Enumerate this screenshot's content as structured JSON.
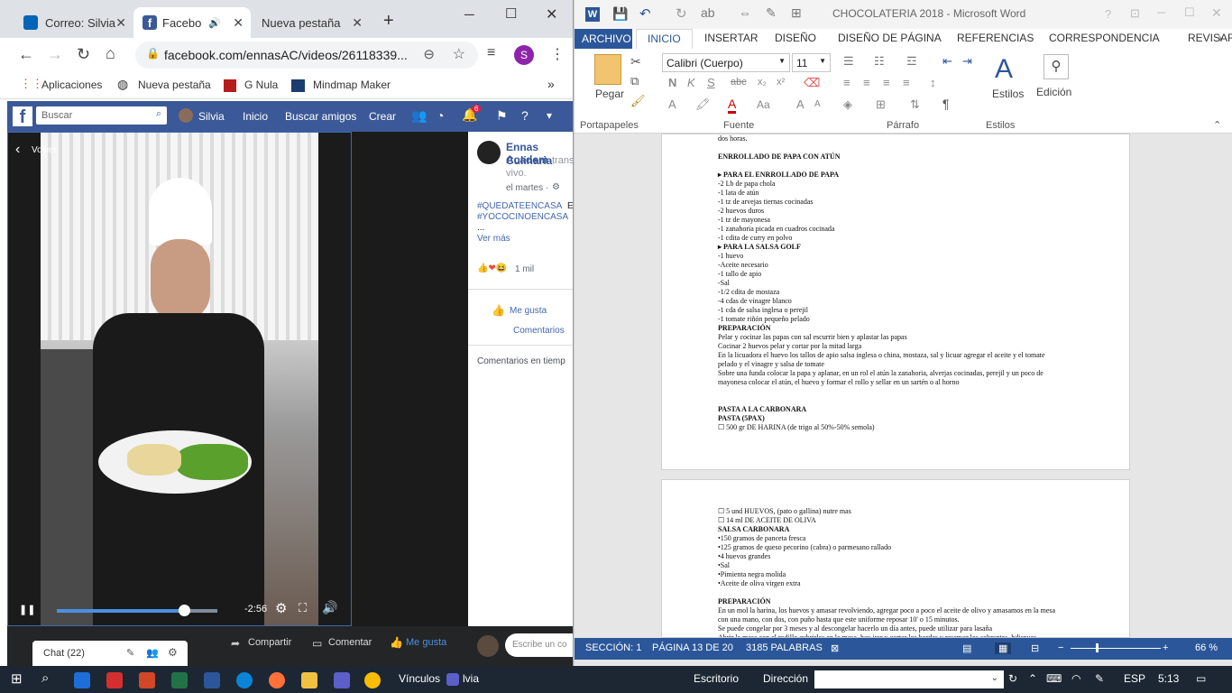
{
  "chrome": {
    "tabs": [
      {
        "label": "Correo: Silvia",
        "active": false
      },
      {
        "label": "Facebo",
        "active": true
      },
      {
        "label": "Nueva pestaña",
        "active": false
      }
    ],
    "new_tab_symbol": "+",
    "url": "facebook.com/ennasAC/videos/26118339...",
    "profile_letter": "S",
    "bookmarks": [
      "Aplicaciones",
      "Nueva pestaña",
      "G Nula",
      "Mindmap Maker"
    ],
    "more_symbol": "»"
  },
  "facebook": {
    "search_placeholder": "Buscar",
    "user": "Silvia",
    "nav": [
      "Inicio",
      "Buscar amigos",
      "Crear"
    ],
    "notification_count": "6",
    "video": {
      "back_label": "Volver",
      "time_remaining": "-2:56",
      "progress": 0.79
    },
    "post": {
      "page_name_1": "Ennas Academ",
      "page_name_2": "Culinaria",
      "suffix": "trans",
      "live": "vivo.",
      "date": "el martes ·",
      "hashtag_1": "#QUEDATEENCASA",
      "hashtag_1_tail": "E",
      "hashtag_2": "#YOCOCINOENCASA",
      "ellipsis": "...",
      "see_more": "Ver más",
      "reactions": "1 mil",
      "like": "Me gusta",
      "comments": "Comentarios",
      "live_comments": "Comentarios en tiemp"
    },
    "bottom": {
      "chat": "Chat (22)",
      "share": "Compartir",
      "comment": "Comentar",
      "like": "Me gusta",
      "write_placeholder": "Escribe un co"
    }
  },
  "word": {
    "title": "CHOCOLATERIA 2018 - Microsoft Word",
    "tabs": [
      "ARCHIVO",
      "INICIO",
      "INSERTAR",
      "DISEÑO",
      "DISEÑO DE PÁGINA",
      "REFERENCIAS",
      "CORRESPONDENCIA",
      "REVISAR"
    ],
    "font_name": "Calibri (Cuerpo)",
    "font_size": "11",
    "paste_label": "Pegar",
    "styles_label": "Estilos",
    "edit_label": "Edición",
    "groups": [
      "Portapapeles",
      "Fuente",
      "Párrafo",
      "Estilos"
    ],
    "page1": [
      {
        "t": "dos horas.",
        "b": false
      },
      {
        "t": "",
        "b": false
      },
      {
        "t": "ENRROLLADO DE PAPA CON ATÚN",
        "b": true
      },
      {
        "t": "",
        "b": false
      },
      {
        "t": "▸ PARA EL ENRROLLADO DE PAPA",
        "b": true
      },
      {
        "t": "-2 Lb de papa chola",
        "b": false
      },
      {
        "t": "-1 lata de atún",
        "b": false
      },
      {
        "t": "-1 tz de arvejas tiernas cocinadas",
        "b": false
      },
      {
        "t": "-2 huevos duros",
        "b": false
      },
      {
        "t": "-1 tz de mayonesa",
        "b": false
      },
      {
        "t": "-1 zanahoria picada en cuadros cocinada",
        "b": false
      },
      {
        "t": "-1 cdita de curry en polvo",
        "b": false
      },
      {
        "t": "▸ PARA LA SALSA GOLF",
        "b": true
      },
      {
        "t": "-1 huevo",
        "b": false
      },
      {
        "t": "-Aceite necesario",
        "b": false
      },
      {
        "t": "-1 tallo de apio",
        "b": false
      },
      {
        "t": "-Sal",
        "b": false
      },
      {
        "t": "-1/2 cdita de mostaza",
        "b": false
      },
      {
        "t": "-4 cdas de vinagre blanco",
        "b": false
      },
      {
        "t": "-1 cda de salsa inglesa o perejil",
        "b": false
      },
      {
        "t": "-1 tomate riñón pequeño pelado",
        "b": false
      },
      {
        "t": "PREPARACIÓN",
        "b": true
      },
      {
        "t": "Pelar y cocinar las papas con sal escurrir bien y aplastar las papas",
        "b": false
      },
      {
        "t": "Cocinar 2 huevos pelar y cortar por la mitad larga",
        "b": false
      },
      {
        "t": "En la licuadora el huevo los tallos de apio salsa inglesa o china, mostaza, sal y licuar agregar el aceite y el tomate",
        "b": false
      },
      {
        "t": "pelado y el vinagre y salsa de tomate",
        "b": false
      },
      {
        "t": "Sobre una funda colocar la papa y aplanar, en un rol el atún la zanahoria, alverjas cocinadas, perejil y un poco de",
        "b": false
      },
      {
        "t": "mayonesa colocar el atún, el huevo y formar el rollo y sellar en un sartén o al horno",
        "b": false
      },
      {
        "t": "",
        "b": false
      },
      {
        "t": "",
        "b": false
      },
      {
        "t": "PASTA A LA CARBONARA",
        "b": true
      },
      {
        "t": "PASTA (5PAX)",
        "b": true
      },
      {
        "t": "☐ 500 gr DE HARINA (de trigo al 50%-50% semola)",
        "b": false
      }
    ],
    "page2": [
      {
        "t": "☐ 5 und HUEVOS, (pato o gallina) nutre mas",
        "b": false
      },
      {
        "t": "☐ 14 ml DE ACEITE DE OLIVA",
        "b": false
      },
      {
        "t": "SALSA CARBONARA",
        "b": true
      },
      {
        "t": "•150 gramos de panceta fresca",
        "b": false
      },
      {
        "t": "•125 gramos de queso pecorino (cabra) o parmesano rallado",
        "b": false
      },
      {
        "t": "•4 huevos grandes",
        "b": false
      },
      {
        "t": "•Sal",
        "b": false
      },
      {
        "t": "•Pimienta negra molida",
        "b": false
      },
      {
        "t": "•Aceite de oliva virgen extra",
        "b": false
      },
      {
        "t": "",
        "b": false
      },
      {
        "t": "PREPARACIÓN",
        "b": true
      },
      {
        "t": "En un mol la harina, los huevos y amasar revolviendo, agregar poco a poco el aceite de olivo y amasamos en la mesa",
        "b": false
      },
      {
        "t": "con una mano, con dos, con puño hasta que este uniforme reposar 10' o 15 minutos.",
        "b": false
      },
      {
        "t": "Se puede congelar por 3 meses y al descongelar hacerlo un día antes, puede utilizar para lasaña",
        "b": false
      },
      {
        "t": "Abrir la masa con el rodillo cubrirlas en la mesa, hay irar y cortar los bordes y reservar los sobrantes, hdispues",
        "b": false
      }
    ],
    "status": {
      "section": "SECCIÓN: 1",
      "page": "PÁGINA 13 DE 20",
      "words": "3185 PALABRAS",
      "zoom": "66 %"
    }
  },
  "taskbar": {
    "links_label": "Vínculos",
    "teams_label": "lvia",
    "desktop_label": "Escritorio",
    "address_label": "Dirección",
    "lang": "ESP",
    "time": "5:13"
  }
}
